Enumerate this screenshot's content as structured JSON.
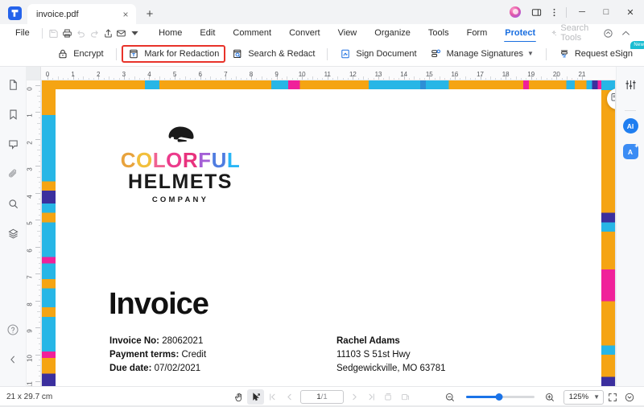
{
  "window": {
    "tab_title": "invoice.pdf",
    "new_tab_label": "+",
    "close_label": "×",
    "minimize_label": "─",
    "maximize_label": "□",
    "window_close_label": "✕",
    "app_logo_name": "pdfelement-logo"
  },
  "menubar": {
    "file_label": "File",
    "items": [
      {
        "label": "Home",
        "active": false
      },
      {
        "label": "Edit",
        "active": false
      },
      {
        "label": "Comment",
        "active": false
      },
      {
        "label": "Convert",
        "active": false
      },
      {
        "label": "View",
        "active": false
      },
      {
        "label": "Organize",
        "active": false
      },
      {
        "label": "Tools",
        "active": false
      },
      {
        "label": "Form",
        "active": false
      },
      {
        "label": "Protect",
        "active": true
      }
    ],
    "search_tools_label": "Search Tools"
  },
  "ribbon": {
    "encrypt_label": "Encrypt",
    "mark_for_redaction_label": "Mark for Redaction",
    "search_and_redact_label": "Search & Redact",
    "sign_document_label": "Sign Document",
    "manage_signatures_label": "Manage Signatures",
    "request_esign_label": "Request eSign",
    "new_badge_label": "New",
    "highlight_color": "#e8332a"
  },
  "ruler": {
    "unit": "cm",
    "h_ticks": [
      "0",
      "1",
      "2",
      "3",
      "4",
      "5",
      "6",
      "7",
      "8",
      "9",
      "10",
      "11",
      "12",
      "13",
      "14",
      "15",
      "16",
      "17",
      "18",
      "19",
      "20",
      "21"
    ],
    "v_ticks": [
      "0",
      "1",
      "2",
      "3",
      "4",
      "5",
      "6",
      "7",
      "8",
      "9",
      "10",
      "11"
    ]
  },
  "document": {
    "logo": {
      "word_colorful": "COLORFUL",
      "colorful_letters": [
        {
          "ch": "C",
          "color": "#e8a33d"
        },
        {
          "ch": "O",
          "color": "#f2c03c"
        },
        {
          "ch": "L",
          "color": "#f06292"
        },
        {
          "ch": "O",
          "color": "#ec3b8c"
        },
        {
          "ch": "R",
          "color": "#e8327d"
        },
        {
          "ch": "F",
          "color": "#a45fd6"
        },
        {
          "ch": "U",
          "color": "#4f7ce0"
        },
        {
          "ch": "L",
          "color": "#29b6f6"
        }
      ],
      "word_helmets": "HELMETS",
      "word_company": "COMPANY",
      "helmet_icon_name": "helmet-icon"
    },
    "title": "Invoice",
    "meta": [
      {
        "label": "Invoice No:",
        "value": "28062021"
      },
      {
        "label": "Payment terms:",
        "value": "Credit"
      },
      {
        "label": "Due date:",
        "value": "07/02/2021"
      }
    ],
    "bill_to": {
      "name": "Rachel Adams",
      "address_line1": "11103 S 51st Hwy",
      "address_line2": "Sedgewickville, MO 63781"
    },
    "border_colors": {
      "orange": "#f5a413",
      "cyan": "#27b6e6",
      "magenta": "#f0219a",
      "purple": "#3b2f9e"
    }
  },
  "left_rail": {
    "items": [
      {
        "name": "thumbnails-icon",
        "label": "Thumbnails"
      },
      {
        "name": "bookmark-icon",
        "label": "Bookmarks"
      },
      {
        "name": "comment-icon",
        "label": "Comments"
      },
      {
        "name": "attachment-icon",
        "label": "Attachments"
      },
      {
        "name": "search-icon",
        "label": "Search"
      },
      {
        "name": "layers-icon",
        "label": "Layers"
      }
    ],
    "help_label": "?",
    "collapse_label": "‹"
  },
  "right_rail": {
    "properties_label": "Properties",
    "ai_label": "AI",
    "translate_label": "A"
  },
  "statusbar": {
    "page_dimensions": "21 x 29.7 cm",
    "current_page": "1",
    "page_separator": "/",
    "total_pages": "1",
    "zoom_level": "125%",
    "tools": [
      {
        "name": "hand-tool-icon",
        "selected": false
      },
      {
        "name": "select-tool-icon",
        "selected": true
      }
    ]
  }
}
